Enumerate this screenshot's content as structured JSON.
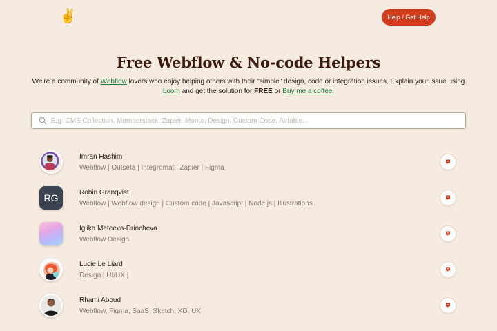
{
  "header": {
    "logo_icon": "victory-hand-icon",
    "logo_glyph": "✌️",
    "help_button_label": "Help / Get Help"
  },
  "hero": {
    "title": "Free Webflow & No-code Helpers",
    "desc_1": "We're a community of ",
    "link_webflow": "Webflow",
    "desc_2": " lovers who enjoy helping others with their \"simple\" design, code or integration issues. Explain your issue using ",
    "link_loom": "Loom",
    "desc_3": " and get the solution for ",
    "desc_free": "FREE",
    "desc_4": " or ",
    "link_coffee": "Buy me a coffee."
  },
  "search": {
    "placeholder": "E.g: CMS Collection, Memberstack, Zapier, Monto, Design, Custom Code, Airtable..."
  },
  "helpers": [
    {
      "name": "Imran Hashim",
      "tags": "Webflow | Outseta | Integromat | Zapier | Figma",
      "avatar_icon": "person-photo-icon"
    },
    {
      "name": "Robin Granqvist",
      "tags": "Webflow | Webflow design | Custom code | Javascript | Node.js | Illustrations",
      "avatar_icon": "rg-monogram-icon",
      "avatar_text": "RG"
    },
    {
      "name": "Iglika Mateeva-Drincheva",
      "tags": "Webflow Design",
      "avatar_icon": "gradient-icon"
    },
    {
      "name": "Lucie Le Liard",
      "tags": "Design | UI/UX |",
      "avatar_icon": "illustrated-person-icon"
    },
    {
      "name": "Rhami Aboud",
      "tags": "Webflow, Figma, SaaS, Sketch, XD, UX",
      "avatar_icon": "person-photo-icon"
    }
  ],
  "colors": {
    "background": "#f6ebe0",
    "accent": "#d23d1e",
    "link": "#1d7a3a"
  }
}
